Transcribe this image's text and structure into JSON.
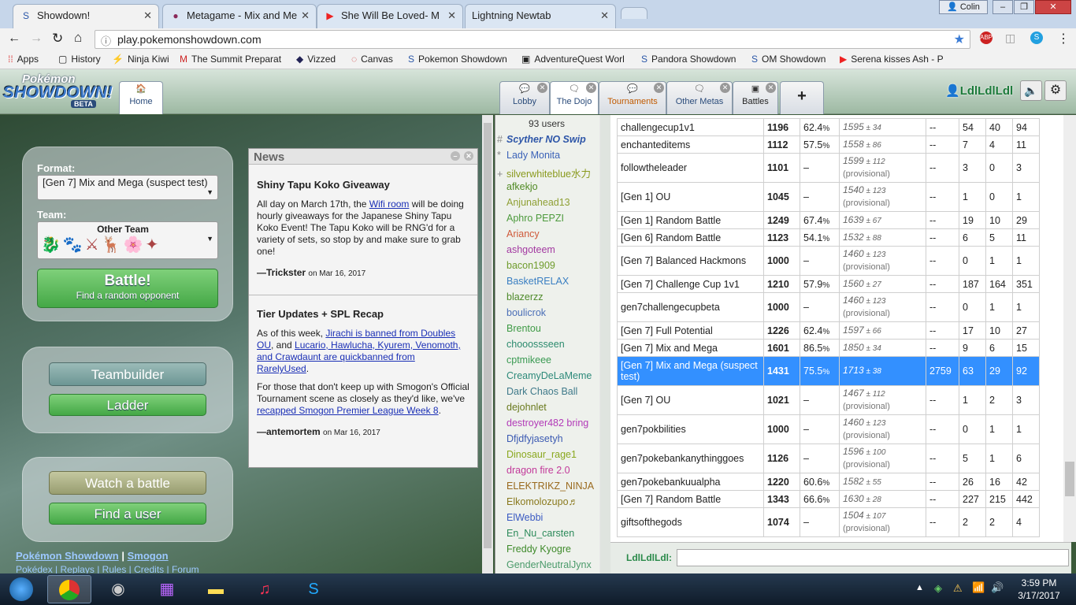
{
  "browser": {
    "tabs": [
      {
        "label": "Showdown!",
        "icon": "pokemon-showdown-icon"
      },
      {
        "label": "Metagame - Mix and Me",
        "icon": "metagame-icon"
      },
      {
        "label": "She Will Be Loved- M",
        "icon": "youtube-icon"
      },
      {
        "label": "Lightning Newtab",
        "icon": "none"
      }
    ],
    "user_badge": "Colin",
    "url": "play.pokemonshowdown.com",
    "bookmarks": [
      "Apps",
      "History",
      "Ninja Kiwi",
      "The Summit Preparat",
      "Vizzed",
      "Canvas",
      "Pokemon Showdown",
      "AdventureQuest Worl",
      "Pandora Showdown",
      "OM Showdown",
      "Serena kisses Ash - P"
    ]
  },
  "header": {
    "logo_top": "Pokémon",
    "logo_main": "SHOWDOWN!",
    "logo_beta": "BETA",
    "home": "Home",
    "tabs": [
      "Lobby",
      "The Dojo",
      "Tournaments",
      "Other Metas",
      "Battles"
    ],
    "add": "+",
    "username": "LdlLdlLdl"
  },
  "main": {
    "format_label": "Format:",
    "format_value": "[Gen 7] Mix and Mega (suspect test)",
    "team_label": "Team:",
    "team_name": "Other Team",
    "battle_label": "Battle!",
    "battle_sub": "Find a random opponent",
    "teambuilder": "Teambuilder",
    "ladder": "Ladder",
    "watch": "Watch a battle",
    "find_user": "Find a user",
    "footer_links1": [
      "Pokémon Showdown",
      "Smogon"
    ],
    "footer_links2": [
      "Pokédex",
      "Replays",
      "Rules",
      "Credits",
      "Forum"
    ]
  },
  "news": {
    "title": "News",
    "items": [
      {
        "heading": "Shiny Tapu Koko Giveaway",
        "body1": "All day on March 17th, the ",
        "link1": "Wifi room",
        "body2": " will be doing hourly giveaways for the Japanese Shiny Tapu Koko Event! The Tapu Koko will be RNG'd for a variety of sets, so stop by and make sure to grab one!",
        "author": "—Trickster",
        "date": "on Mar 16, 2017"
      },
      {
        "heading": "Tier Updates + SPL Recap",
        "body1": "As of this week, ",
        "link1": "Jirachi is banned from Doubles OU",
        "body2": ", and ",
        "link2": "Lucario, Hawlucha, Kyurem, Venomoth, and Crawdaunt are quickbanned from RarelyUsed",
        "body3": ".",
        "body4": "For those that don't keep up with Smogon's Official Tournament scene as closely as they'd like, we've ",
        "link3": "recapped Smogon Premier League Week 8",
        "body5": ".",
        "author": "—antemortem",
        "date": "on Mar 16, 2017"
      }
    ]
  },
  "users": {
    "count": "93 users",
    "list": [
      {
        "name": "Scyther NO Swip",
        "prefix": "#",
        "color": "#2e56a8"
      },
      {
        "name": "Lady Monita",
        "prefix": "*",
        "color": "#3c63b8"
      },
      {
        "name": "silverwhiteblue水力",
        "prefix": "+",
        "color": "#8a9a1e"
      },
      {
        "name": "afkekjo",
        "prefix": "",
        "color": "#508a23"
      },
      {
        "name": "Anjunahead13",
        "prefix": "",
        "color": "#8fa035"
      },
      {
        "name": "Aphro PEPZI",
        "prefix": "",
        "color": "#4c9a3c"
      },
      {
        "name": "Ariancy",
        "prefix": "",
        "color": "#cf5a3a"
      },
      {
        "name": "ashgoteem",
        "prefix": "",
        "color": "#a33aa1"
      },
      {
        "name": "bacon1909",
        "prefix": "",
        "color": "#6f9c2c"
      },
      {
        "name": "BasketRELAX",
        "prefix": "",
        "color": "#3a7fc2"
      },
      {
        "name": "blazerzz",
        "prefix": "",
        "color": "#4e8a2a"
      },
      {
        "name": "boulicrok",
        "prefix": "",
        "color": "#4b6fb7"
      },
      {
        "name": "Brentou",
        "prefix": "",
        "color": "#3e9a45"
      },
      {
        "name": "chooossseen",
        "prefix": "",
        "color": "#2c8b6e"
      },
      {
        "name": "cptmikeee",
        "prefix": "",
        "color": "#3a9a52"
      },
      {
        "name": "CreamyDeLaMeme",
        "prefix": "",
        "color": "#2d8a7a"
      },
      {
        "name": "Dark Chaos Ball",
        "prefix": "",
        "color": "#3f7a8a"
      },
      {
        "name": "dejohnlet",
        "prefix": "",
        "color": "#6a7a1e"
      },
      {
        "name": "destroyer482 bring",
        "prefix": "",
        "color": "#b23ab8"
      },
      {
        "name": "Dfjdfyjasetyh",
        "prefix": "",
        "color": "#3b5ab2"
      },
      {
        "name": "Dinosaur_rage1",
        "prefix": "",
        "color": "#8aa81e"
      },
      {
        "name": "dragon fire 2.0",
        "prefix": "",
        "color": "#c23a9a"
      },
      {
        "name": "ELEKTRIKZ_NINJA",
        "prefix": "",
        "color": "#9a6a1e"
      },
      {
        "name": "Elkomolozupo♬",
        "prefix": "",
        "color": "#8a7a1e"
      },
      {
        "name": "ElWebbi",
        "prefix": "",
        "color": "#3a5ac2"
      },
      {
        "name": "En_Nu_carsten",
        "prefix": "",
        "color": "#2c8a5a"
      },
      {
        "name": "Freddy Kyogre",
        "prefix": "",
        "color": "#3e8a2a"
      },
      {
        "name": "GenderNeutralJynx",
        "prefix": "",
        "color": "#4a9a6a"
      }
    ]
  },
  "ladder": {
    "rows": [
      {
        "format": "challengecup1v1",
        "elo": "1196",
        "gxe": "62.4",
        "gxe_dec": "%",
        "glicko": "1595",
        "dev": "34",
        "prov": false,
        "coil": "--",
        "w": "54",
        "l": "40",
        "t": "94"
      },
      {
        "format": "enchanteditems",
        "elo": "1112",
        "gxe": "57.5",
        "gxe_dec": "%",
        "glicko": "1558",
        "dev": "86",
        "prov": false,
        "coil": "--",
        "w": "7",
        "l": "4",
        "t": "11"
      },
      {
        "format": "followtheleader",
        "elo": "1101",
        "gxe": "–",
        "gxe_dec": "",
        "glicko": "1599",
        "dev": "112",
        "prov": true,
        "coil": "--",
        "w": "3",
        "l": "0",
        "t": "3"
      },
      {
        "format": "[Gen 1] OU",
        "elo": "1045",
        "gxe": "–",
        "gxe_dec": "",
        "glicko": "1540",
        "dev": "123",
        "prov": true,
        "coil": "--",
        "w": "1",
        "l": "0",
        "t": "1"
      },
      {
        "format": "[Gen 1] Random Battle",
        "elo": "1249",
        "gxe": "67.4",
        "gxe_dec": "%",
        "glicko": "1639",
        "dev": "67",
        "prov": false,
        "coil": "--",
        "w": "19",
        "l": "10",
        "t": "29"
      },
      {
        "format": "[Gen 6] Random Battle",
        "elo": "1123",
        "gxe": "54.1",
        "gxe_dec": "%",
        "glicko": "1532",
        "dev": "88",
        "prov": false,
        "coil": "--",
        "w": "6",
        "l": "5",
        "t": "11"
      },
      {
        "format": "[Gen 7] Balanced Hackmons",
        "elo": "1000",
        "gxe": "–",
        "gxe_dec": "",
        "glicko": "1460",
        "dev": "123",
        "prov": true,
        "coil": "--",
        "w": "0",
        "l": "1",
        "t": "1"
      },
      {
        "format": "[Gen 7] Challenge Cup 1v1",
        "elo": "1210",
        "gxe": "57.9",
        "gxe_dec": "%",
        "glicko": "1560",
        "dev": "27",
        "prov": false,
        "coil": "--",
        "w": "187",
        "l": "164",
        "t": "351"
      },
      {
        "format": "gen7challengecupbeta",
        "elo": "1000",
        "gxe": "–",
        "gxe_dec": "",
        "glicko": "1460",
        "dev": "123",
        "prov": true,
        "coil": "--",
        "w": "0",
        "l": "1",
        "t": "1"
      },
      {
        "format": "[Gen 7] Full Potential",
        "elo": "1226",
        "gxe": "62.4",
        "gxe_dec": "%",
        "glicko": "1597",
        "dev": "66",
        "prov": false,
        "coil": "--",
        "w": "17",
        "l": "10",
        "t": "27"
      },
      {
        "format": "[Gen 7] Mix and Mega",
        "elo": "1601",
        "gxe": "86.5",
        "gxe_dec": "%",
        "glicko": "1850",
        "dev": "34",
        "prov": false,
        "coil": "--",
        "w": "9",
        "l": "6",
        "t": "15"
      },
      {
        "format": "[Gen 7] Mix and Mega (suspect test)",
        "elo": "1431",
        "gxe": "75.5",
        "gxe_dec": "%",
        "glicko": "1713",
        "dev": "38",
        "prov": false,
        "coil": "2759",
        "w": "63",
        "l": "29",
        "t": "92",
        "selected": true
      },
      {
        "format": "[Gen 7] OU",
        "elo": "1021",
        "gxe": "–",
        "gxe_dec": "",
        "glicko": "1467",
        "dev": "112",
        "prov": true,
        "coil": "--",
        "w": "1",
        "l": "2",
        "t": "3"
      },
      {
        "format": "gen7pokbilities",
        "elo": "1000",
        "gxe": "–",
        "gxe_dec": "",
        "glicko": "1460",
        "dev": "123",
        "prov": true,
        "coil": "--",
        "w": "0",
        "l": "1",
        "t": "1"
      },
      {
        "format": "gen7pokebankanythinggoes",
        "elo": "1126",
        "gxe": "–",
        "gxe_dec": "",
        "glicko": "1596",
        "dev": "100",
        "prov": true,
        "coil": "--",
        "w": "5",
        "l": "1",
        "t": "6"
      },
      {
        "format": "gen7pokebankuualpha",
        "elo": "1220",
        "gxe": "60.6",
        "gxe_dec": "%",
        "glicko": "1582",
        "dev": "55",
        "prov": false,
        "coil": "--",
        "w": "26",
        "l": "16",
        "t": "42"
      },
      {
        "format": "[Gen 7] Random Battle",
        "elo": "1343",
        "gxe": "66.6",
        "gxe_dec": "%",
        "glicko": "1630",
        "dev": "28",
        "prov": false,
        "coil": "--",
        "w": "227",
        "l": "215",
        "t": "442"
      },
      {
        "format": "giftsofthegods",
        "elo": "1074",
        "gxe": "–",
        "gxe_dec": "",
        "glicko": "1504",
        "dev": "107",
        "prov": true,
        "coil": "--",
        "w": "2",
        "l": "2",
        "t": "4"
      }
    ],
    "prov_label": "(provisional)",
    "chat_user": "LdlLdlLdl:"
  },
  "taskbar": {
    "time": "3:59 PM",
    "date": "3/17/2017"
  },
  "colors": {
    "accent": "#44a846",
    "selection": "#3390ff",
    "link": "#1a2fb5"
  }
}
